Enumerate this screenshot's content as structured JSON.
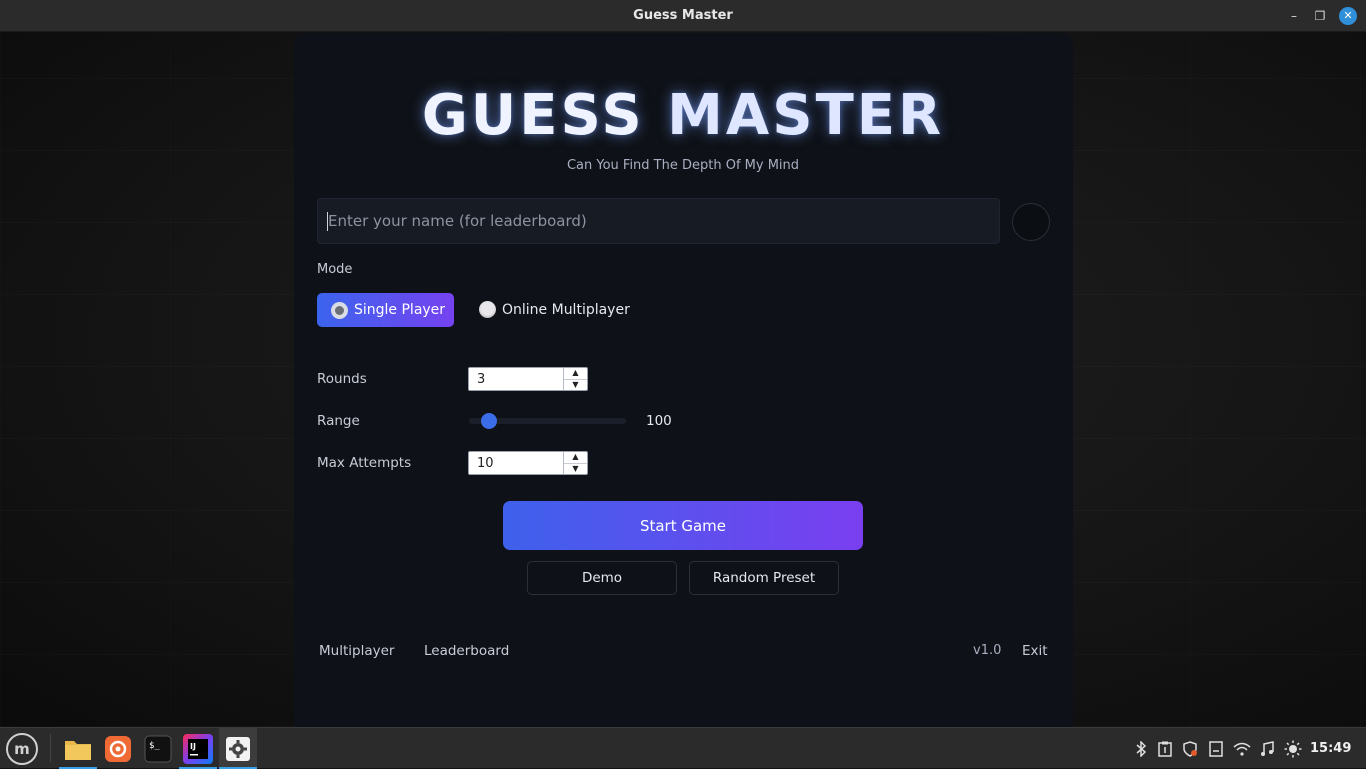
{
  "window": {
    "title": "Guess Master",
    "minimize_glyph": "–",
    "maximize_glyph": "❐",
    "close_glyph": "✕"
  },
  "app": {
    "title_word1": "GUESS",
    "title_word2": "MASTER",
    "subtitle": "Can You Find The Depth Of My Mind",
    "name_placeholder": "Enter your name (for leaderboard)",
    "mode_label": "Mode",
    "mode_options": [
      {
        "label": "Single Player",
        "selected": true
      },
      {
        "label": "Online Multiplayer",
        "selected": false
      }
    ],
    "rounds_label": "Rounds",
    "rounds_value": "3",
    "range_label": "Range",
    "range_value": "100",
    "range_slider_fraction": 0.05,
    "max_attempts_label": "Max Attempts",
    "max_attempts_value": "10",
    "start_button": "Start Game",
    "demo_button": "Demo",
    "random_button": "Random Preset",
    "footer_multiplayer": "Multiplayer",
    "footer_leaderboard": "Leaderboard",
    "version": "v1.0",
    "exit": "Exit"
  },
  "taskbar": {
    "apps": [
      "menu-icon",
      "files-icon",
      "firefox-icon",
      "terminal-icon",
      "intellij-icon",
      "settings-icon"
    ],
    "clock": "15:49",
    "tray": [
      "bluetooth-icon",
      "clipboard-icon",
      "shield-icon",
      "notes-icon",
      "wifi-icon",
      "music-icon",
      "brightness-icon"
    ],
    "accent_color": "#3aa0e6"
  },
  "colors": {
    "accent_start": "#3e61ec",
    "accent_end": "#7a3ff0",
    "panel_bg": "#0e1117"
  }
}
